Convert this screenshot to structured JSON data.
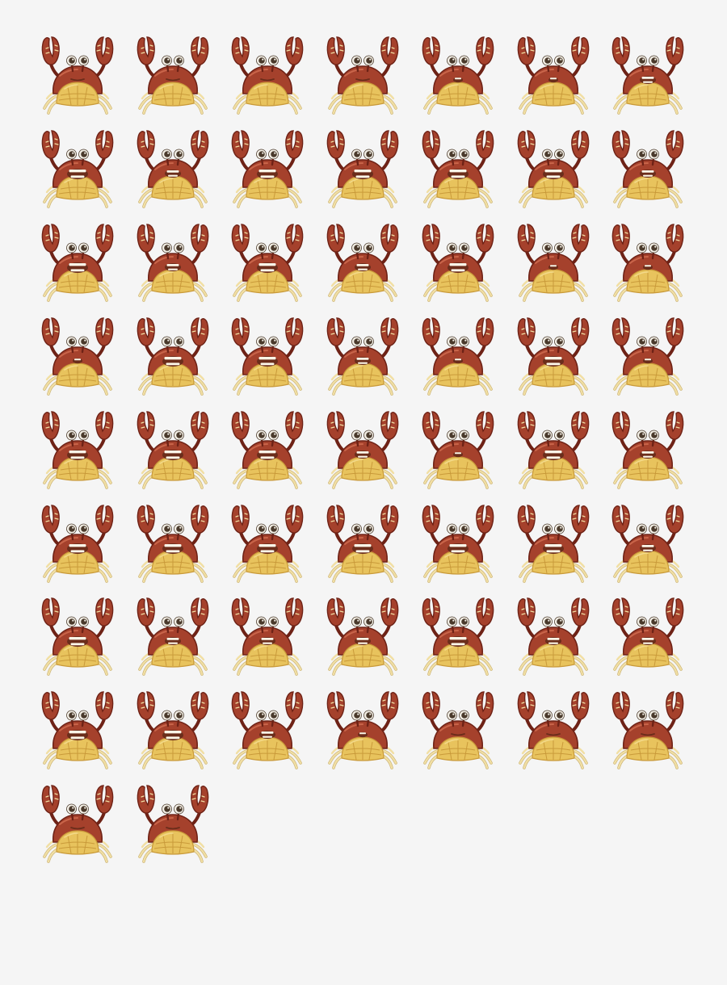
{
  "sprite_sheet": {
    "subject": "crab",
    "columns": 7,
    "frame_count": 58,
    "colors": {
      "background": "#f5f5f5",
      "shell": "#a5412c",
      "shell_dark": "#6e2216",
      "shell_light": "#c9654a",
      "belly": "#e8c35d",
      "belly_dark": "#c99a3a",
      "belly_light": "#f3da8a",
      "legs": "#f1dfa4",
      "legs_dark": "#c9b070",
      "eye_white": "#f3efe6",
      "pupil": "#4a3a2c",
      "mouth": "#6b2d1b",
      "teeth": "#fbf6e8"
    },
    "frames": [
      {
        "mouth": "closed"
      },
      {
        "mouth": "closed"
      },
      {
        "mouth": "closed"
      },
      {
        "mouth": "closed"
      },
      {
        "mouth": "small"
      },
      {
        "mouth": "small"
      },
      {
        "mouth": "open"
      },
      {
        "mouth": "wide"
      },
      {
        "mouth": "open"
      },
      {
        "mouth": "wide"
      },
      {
        "mouth": "wide"
      },
      {
        "mouth": "wide"
      },
      {
        "mouth": "wide"
      },
      {
        "mouth": "open"
      },
      {
        "mouth": "wide"
      },
      {
        "mouth": "open"
      },
      {
        "mouth": "wide"
      },
      {
        "mouth": "open"
      },
      {
        "mouth": "wide"
      },
      {
        "mouth": "small"
      },
      {
        "mouth": "small"
      },
      {
        "mouth": "small"
      },
      {
        "mouth": "wide"
      },
      {
        "mouth": "wide"
      },
      {
        "mouth": "open"
      },
      {
        "mouth": "small"
      },
      {
        "mouth": "wide"
      },
      {
        "mouth": "small"
      },
      {
        "mouth": "wide"
      },
      {
        "mouth": "wide"
      },
      {
        "mouth": "wide"
      },
      {
        "mouth": "open"
      },
      {
        "mouth": "small"
      },
      {
        "mouth": "wide"
      },
      {
        "mouth": "open"
      },
      {
        "mouth": "wide"
      },
      {
        "mouth": "wide"
      },
      {
        "mouth": "wide"
      },
      {
        "mouth": "wide"
      },
      {
        "mouth": "wide"
      },
      {
        "mouth": "wide"
      },
      {
        "mouth": "open"
      },
      {
        "mouth": "wide"
      },
      {
        "mouth": "open"
      },
      {
        "mouth": "open"
      },
      {
        "mouth": "open"
      },
      {
        "mouth": "wide"
      },
      {
        "mouth": "open"
      },
      {
        "mouth": "open"
      },
      {
        "mouth": "wide"
      },
      {
        "mouth": "wide"
      },
      {
        "mouth": "open"
      },
      {
        "mouth": "small"
      },
      {
        "mouth": "closed"
      },
      {
        "mouth": "closed"
      },
      {
        "mouth": "closed"
      },
      {
        "mouth": "closed"
      },
      {
        "mouth": "closed"
      }
    ]
  }
}
